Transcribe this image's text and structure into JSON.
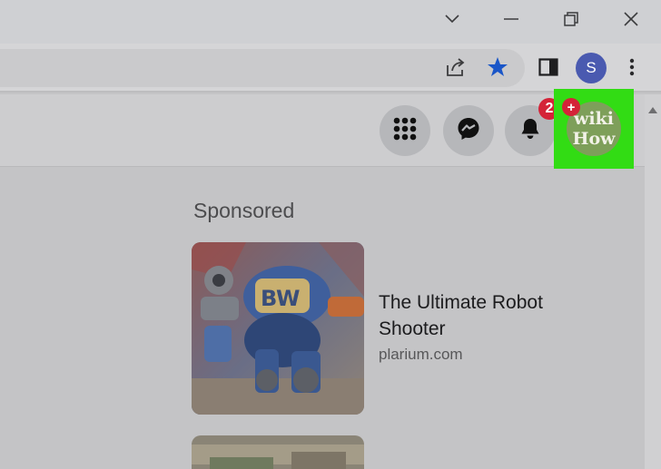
{
  "window_controls": {
    "icons": [
      "chevron-down-icon",
      "minimize-icon",
      "restore-icon",
      "close-icon"
    ]
  },
  "toolbar": {
    "profile_initial": "S",
    "icons": [
      "share-icon",
      "bookmark-star-icon",
      "side-panel-icon",
      "more-vert-icon"
    ],
    "star_color": "#1a56c8"
  },
  "fb_header": {
    "icons": [
      "menu-grid-icon",
      "messenger-icon",
      "notifications-bell-icon"
    ],
    "notification_count": "2",
    "plus_badge": "+",
    "profile_text_line1": "wiki",
    "profile_text_line2": "How",
    "highlight_color": "#32dc14"
  },
  "main": {
    "sponsored_heading": "Sponsored",
    "ads": [
      {
        "title": "The Ultimate Robot Shooter",
        "domain": "plarium.com",
        "image": "robot-mech-image"
      }
    ]
  }
}
